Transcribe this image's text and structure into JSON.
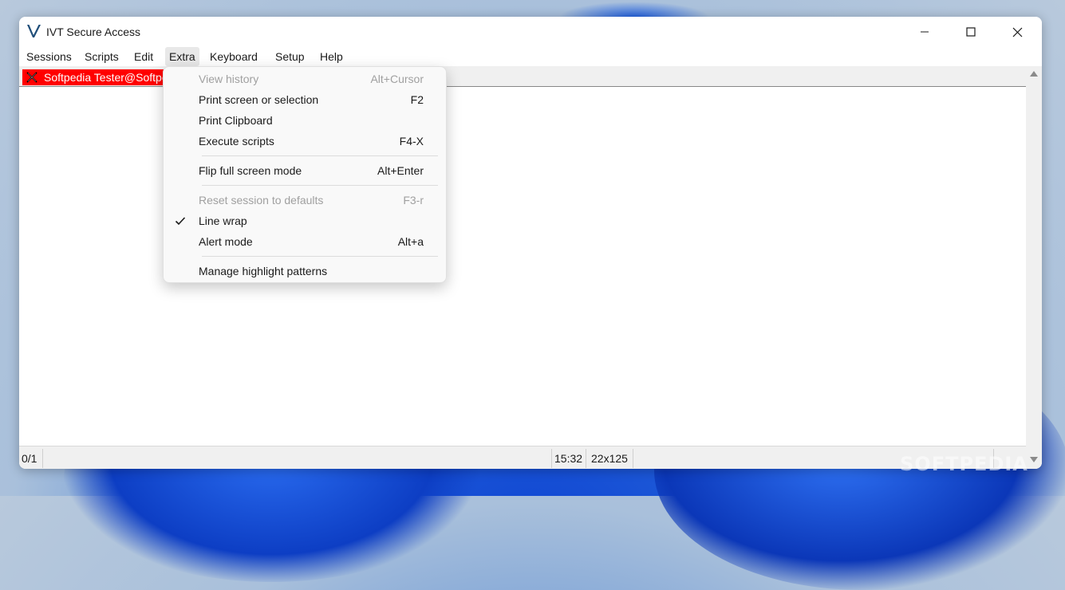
{
  "window": {
    "title": "IVT Secure Access",
    "controls": {
      "minimize": "minimize",
      "maximize": "maximize",
      "close": "close"
    }
  },
  "menubar": {
    "items": [
      "Sessions",
      "Scripts",
      "Edit",
      "Extra",
      "Keyboard",
      "Setup",
      "Help"
    ],
    "active": "Extra"
  },
  "session_tab": {
    "label": "Softpedia Tester@Softpedia",
    "color": "#ff0000"
  },
  "extra_menu": {
    "items": [
      {
        "label": "View history",
        "shortcut": "Alt+Cursor",
        "enabled": false
      },
      {
        "label": "Print screen or selection",
        "shortcut": "F2",
        "enabled": true
      },
      {
        "label": "Print Clipboard",
        "shortcut": "",
        "enabled": true
      },
      {
        "label": "Execute scripts",
        "shortcut": "F4-X",
        "enabled": true
      },
      {
        "label": "Flip full screen mode",
        "shortcut": "Alt+Enter",
        "enabled": true
      },
      {
        "label": "Reset session to defaults",
        "shortcut": "F3-r",
        "enabled": false
      },
      {
        "label": "Line wrap",
        "shortcut": "",
        "enabled": true,
        "checked": true
      },
      {
        "label": "Alert mode",
        "shortcut": "Alt+a",
        "enabled": true
      },
      {
        "label": "Manage highlight patterns",
        "shortcut": "",
        "enabled": true
      }
    ]
  },
  "statusbar": {
    "position": "0/1",
    "time": "15:32",
    "size": "22x125"
  },
  "watermark": "SOFTPEDIA"
}
